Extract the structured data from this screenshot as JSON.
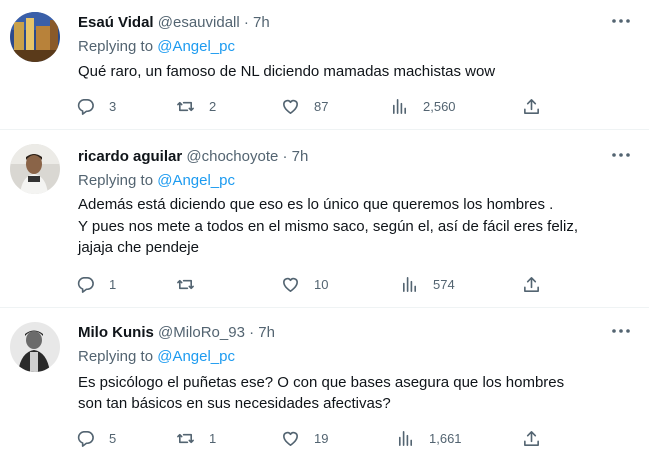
{
  "tweets": [
    {
      "name": "Esaú Vidal",
      "handle": "@esauvidall",
      "time": "7h",
      "replying_prefix": "Replying to",
      "replying_to": "@Angel_pc",
      "text": "Qué raro, un famoso de NL diciendo mamadas machistas wow",
      "replies": "3",
      "retweets": "2",
      "likes": "87",
      "views": "2,560"
    },
    {
      "name": "ricardo aguilar",
      "handle": "@chochoyote",
      "time": "7h",
      "replying_prefix": "Replying to",
      "replying_to": "@Angel_pc",
      "text": "Además está diciendo que eso es lo único que queremos los hombres .\nY pues nos mete a todos en el mismo saco, según el, así de fácil eres feliz,\njajaja che pendeje",
      "replies": "1",
      "retweets": "",
      "likes": "10",
      "views": "574"
    },
    {
      "name": "Milo Kunis",
      "handle": "@MiloRo_93",
      "time": "7h",
      "replying_prefix": "Replying to",
      "replying_to": "@Angel_pc",
      "text": "Es psicólogo el puñetas ese? O con que bases asegura que los hombres\nson tan básicos en sus necesidades afectivas?",
      "replies": "5",
      "retweets": "1",
      "likes": "19",
      "views": "1,661"
    }
  ],
  "icons": {
    "reply": "reply-icon",
    "retweet": "retweet-icon",
    "like": "heart-icon",
    "views": "views-chart-icon",
    "share": "share-icon",
    "more": "more-dots-icon"
  },
  "colors": {
    "link": "#1d9bf0",
    "muted": "#536471",
    "text": "#0f1419",
    "divider": "#eff3f4"
  }
}
